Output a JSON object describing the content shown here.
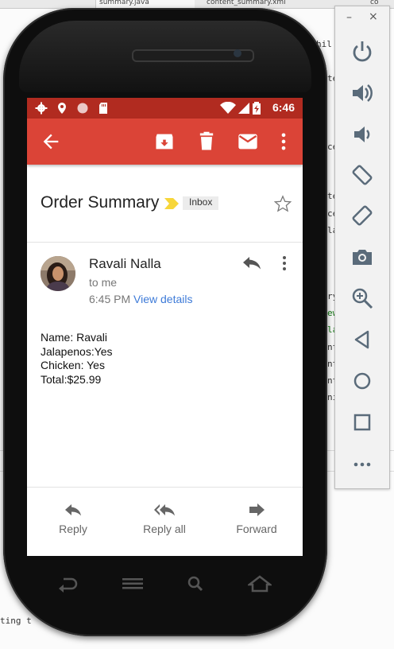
{
  "ide": {
    "tabs": [
      "summary.java",
      "content_summary.xml",
      "co"
    ],
    "frags": [
      "hil",
      "te",
      "ce",
      "te",
      "ce",
      "la",
      "ry",
      "ew",
      "la",
      "nt",
      "nt",
      "nt",
      "ni",
      "ting t"
    ]
  },
  "status_bar": {
    "time": "6:46"
  },
  "app_bar": {
    "back_icon": "arrow-back-icon",
    "archive_icon": "archive-icon",
    "delete_icon": "trash-icon",
    "mail_icon": "mail-icon",
    "more_icon": "more-vert-icon"
  },
  "email": {
    "subject": "Order Summary",
    "label": "Inbox",
    "sender": "Ravali Nalla",
    "to": "to me",
    "time": "6:45 PM",
    "view_details": "View details",
    "body": [
      "Name: Ravali",
      "Jalapenos:Yes",
      "Chicken: Yes",
      "Total:$25.99"
    ]
  },
  "actions": {
    "reply": "Reply",
    "reply_all": "Reply all",
    "forward": "Forward"
  },
  "emulator": {
    "minimize": "–",
    "close": "×"
  },
  "colors": {
    "app_bar": "#db4437",
    "status_bar": "#b12b20",
    "link": "#3e7bd8"
  }
}
